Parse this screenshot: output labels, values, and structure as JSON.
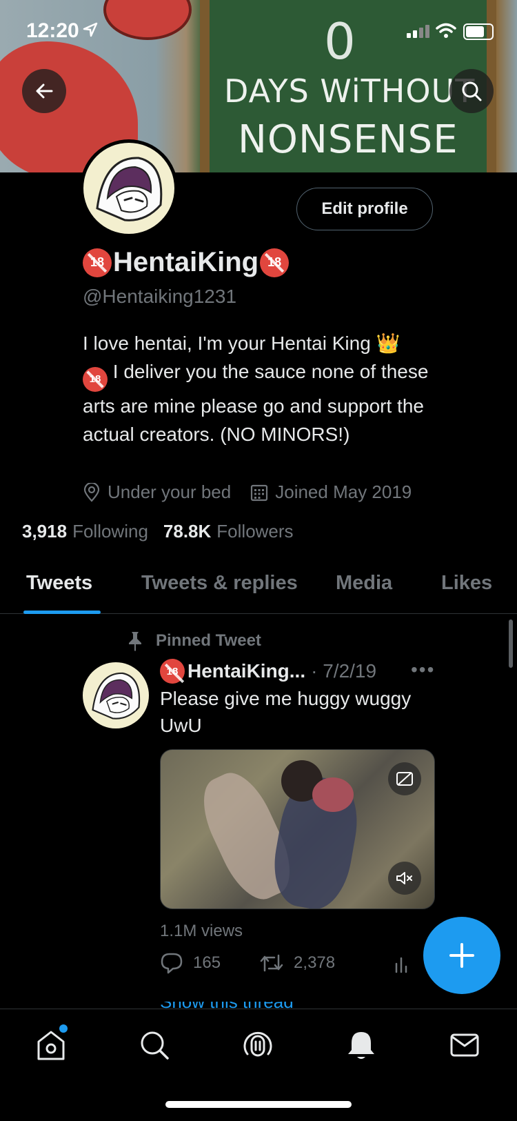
{
  "status_bar": {
    "time": "12:20"
  },
  "banner": {
    "sign_number": "0",
    "sign_line1": "DAYS WiTHOUT",
    "sign_line2": "NONSENSE"
  },
  "profile": {
    "name": "HentaiKing",
    "handle": "@Hentaiking1231",
    "bio_line1": "I love hentai, I'm your Hentai King 👑",
    "bio_rest": " I deliver you the sauce none of these arts are mine please go and support the actual creators. (NO MINORS!)",
    "location": "Under your bed",
    "joined": "Joined May 2019",
    "following_count": "3,918",
    "following_label": "Following",
    "followers_count": "78.8K",
    "followers_label": "Followers",
    "edit_button": "Edit profile",
    "badge_text": "18"
  },
  "tabs": [
    {
      "label": "Tweets",
      "active": true
    },
    {
      "label": "Tweets & replies",
      "active": false
    },
    {
      "label": "Media",
      "active": false
    },
    {
      "label": "Likes",
      "active": false
    }
  ],
  "pinned_tweet": {
    "pinned_label": "Pinned Tweet",
    "name": "HentaiKing...",
    "date": "· 7/2/19",
    "more": "•••",
    "text": "Please give me huggy wuggy UwU",
    "views": "1.1M views",
    "replies": "165",
    "retweets": "2,378",
    "show_thread": "Show this thread"
  },
  "colors": {
    "accent": "#1d9bf0",
    "background": "#000000",
    "muted": "#71767b",
    "badge": "#e1463e"
  },
  "icons": {
    "back": "arrow-left-icon",
    "search": "search-icon",
    "location": "map-pin-icon",
    "calendar": "calendar-icon",
    "pin": "pin-icon",
    "reply": "reply-icon",
    "retweet": "retweet-icon",
    "analytics": "analytics-icon",
    "compose": "plus-icon",
    "home": "home-icon",
    "explore": "search-icon",
    "spaces": "spaces-icon",
    "notifications": "bell-icon",
    "messages": "mail-icon"
  }
}
